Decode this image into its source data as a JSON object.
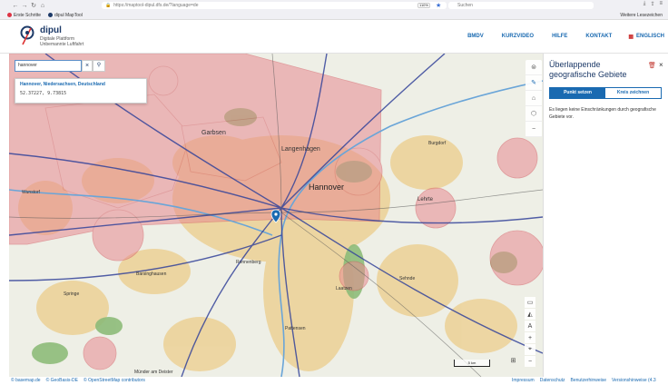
{
  "browser": {
    "url": "https://maptool-dipul.dfs.de/?language=de",
    "zoom": "110%",
    "search_placeholder": "Suchen",
    "bookmarks": [
      "Erste Schritte",
      "dipul MapTool"
    ],
    "other_bookmarks": "Weitere Lesezeichen"
  },
  "app": {
    "title": "dipul",
    "subtitle_1": "Digitale Plattform",
    "subtitle_2": "Unbemannte Luftfahrt"
  },
  "nav": {
    "items": [
      "BMDV",
      "KURZVIDEO",
      "HILFE",
      "KONTAKT",
      "ENGLISCH"
    ]
  },
  "search": {
    "value": "hannover",
    "result_name": "Hannover, Niedersachsen, Deutschland",
    "result_coords": "52.37227, 9.73815"
  },
  "map_labels": {
    "garbsen": "Garbsen",
    "langenhagen": "Langenhagen",
    "hannover": "Hannover",
    "lehrte": "Lehrte",
    "burgdorf": "Burgdorf",
    "barsinghausen": "Barsinghausen",
    "ronnenberg": "Ronnenberg",
    "laatzen": "Laatzen",
    "sehnde": "Sehnde",
    "pattensen": "Pattensen",
    "springe": "Springe",
    "muender": "Münder am Deister",
    "wunstorf": "Wunstorf"
  },
  "map": {
    "scale_label": "5 km",
    "colors": {
      "restricted_zone": "#e88b91",
      "town_area": "#e8c77a",
      "forest": "#7ab06c",
      "road": "#2f3f8f",
      "water": "#6aa5d8"
    }
  },
  "sidebar": {
    "title": "Überlappende geografische Gebiete",
    "tab_point": "Punkt setzen",
    "tab_circle": "Kreis zeichnen",
    "message": "Es liegen keine Einschränkungen durch geografische Gebiete vor."
  },
  "footer": {
    "attributions": [
      "© basemap.de",
      "© GeoBasis-DE",
      "© OpenStreetMap contributors"
    ],
    "links": [
      "Impressum",
      "Datenschutz",
      "Benutzerhinweise",
      "Versionshinweise (4.3"
    ]
  }
}
